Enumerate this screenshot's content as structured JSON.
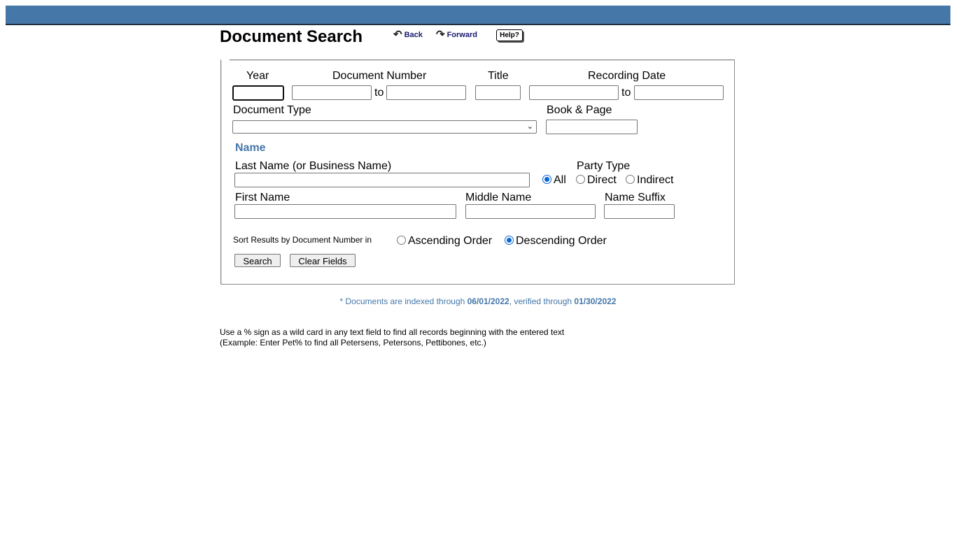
{
  "header": {
    "title": "Document Search",
    "back_label": "Back",
    "forward_label": "Forward",
    "help_label": "Help?"
  },
  "form": {
    "year_label": "Year",
    "doc_number_label": "Document Number",
    "to_label_1": "to",
    "title_label": "Title",
    "recording_date_label": "Recording Date",
    "to_label_2": "to",
    "document_type_label": "Document Type",
    "document_type_selected": "",
    "book_page_label": "Book & Page",
    "name_section": "Name",
    "last_name_label": "Last Name (or Business Name)",
    "party_type_label": "Party Type",
    "party_all": "All",
    "party_direct": "Direct",
    "party_indirect": "Indirect",
    "first_name_label": "First Name",
    "middle_name_label": "Middle Name",
    "name_suffix_label": "Name Suffix",
    "sort_label": "Sort Results by Document Number in",
    "sort_ascending": "Ascending Order",
    "sort_descending": "Descending Order",
    "search_button": "Search",
    "clear_button": "Clear Fields"
  },
  "notice": {
    "prefix": "* Documents are indexed through ",
    "indexed_date": "06/01/2022",
    "middle": ", verified through ",
    "verified_date": "01/30/2022"
  },
  "tips": {
    "line1": "Use a % sign as a wild card in any text field to find all records beginning with the entered text",
    "line2": "(Example: Enter Pet% to find all Petersens, Petersons, Pettibones, etc.)"
  },
  "colors": {
    "accent": "#4577a9",
    "radio_selected": "#0a66d6"
  }
}
